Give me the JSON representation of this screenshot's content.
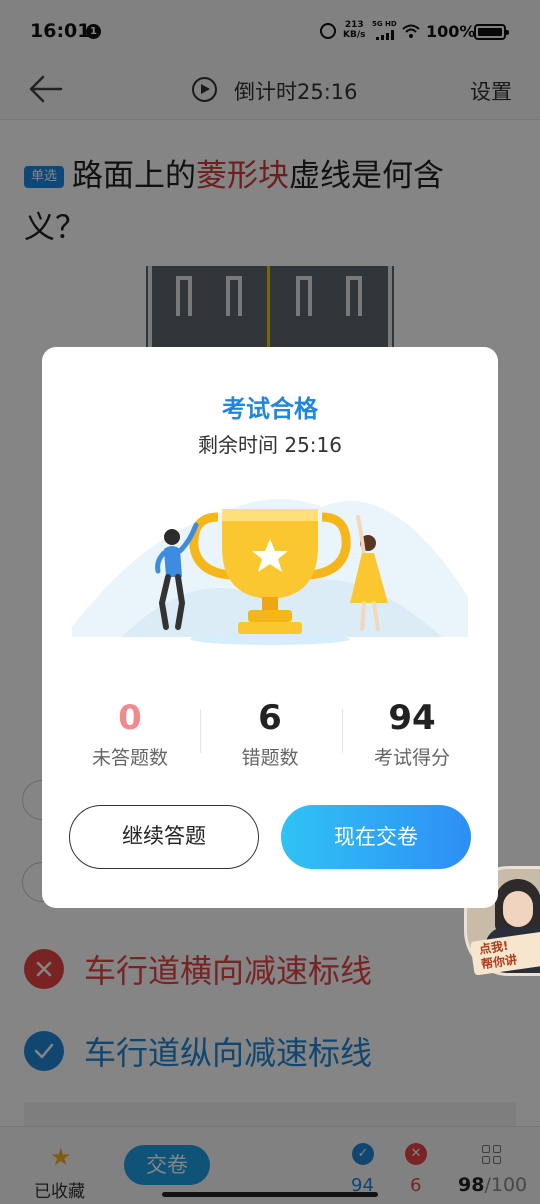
{
  "status_bar": {
    "time": "16:01",
    "notification_count": "1",
    "net_speed_value": "213",
    "net_speed_unit": "KB/s",
    "network": "5G HD",
    "battery": "100%"
  },
  "header": {
    "timer": "倒计时25:16",
    "settings": "设置"
  },
  "question": {
    "type_tag": "单选",
    "text_before": "路面上的",
    "text_highlight": "菱形块",
    "text_after": "虚线是何含义？"
  },
  "options": [
    {
      "label": "车行道横向减速标线",
      "state": "wrong"
    },
    {
      "label": "车行道纵向减速标线",
      "state": "correct"
    }
  ],
  "bottom_bar": {
    "favorite_label": "已收藏",
    "submit_label": "交卷",
    "correct_count": "94",
    "wrong_count": "6",
    "progress_current": "98",
    "progress_total": "/100"
  },
  "helper": {
    "line1": "点我!",
    "line2": "帮你讲"
  },
  "modal": {
    "title": "考试合格",
    "remaining": "剩余时间 25:16",
    "stats": [
      {
        "value": "0",
        "label": "未答题数",
        "color": "#f08b8b"
      },
      {
        "value": "6",
        "label": "错题数",
        "color": "#222222"
      },
      {
        "value": "94",
        "label": "考试得分",
        "color": "#222222"
      }
    ],
    "continue_label": "继续答题",
    "submit_label": "现在交卷"
  },
  "colors": {
    "accent_blue": "#2287db",
    "wrong_red": "#e84545",
    "submit_gradient_start": "#2fc3f4",
    "submit_gradient_end": "#2e8ef5"
  }
}
